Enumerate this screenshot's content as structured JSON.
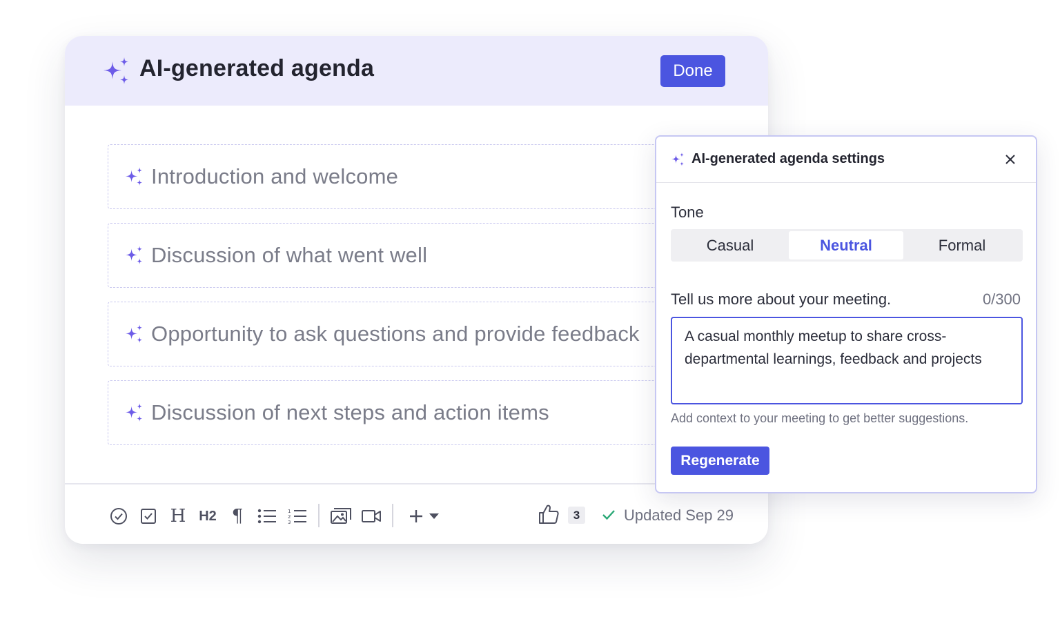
{
  "colors": {
    "accent": "#4b55e0",
    "sparkle": "#6d5ce8",
    "header_bg": "#ecebfc",
    "check_green": "#2aa876"
  },
  "card": {
    "title": "AI-generated agenda",
    "done_label": "Done",
    "agenda_items": [
      {
        "text": "Introduction and welcome",
        "icon": "sparkle-icon"
      },
      {
        "text": "Discussion of what went well",
        "icon": "sparkle-icon"
      },
      {
        "text": "Opportunity to ask questions and provide feedback",
        "icon": "sparkle-icon"
      },
      {
        "text": "Discussion of next steps and action items",
        "icon": "sparkle-icon"
      }
    ],
    "toolbar": {
      "heading_label": "H",
      "h2_label": "H2",
      "paragraph_label": "¶",
      "like_count": "3",
      "updated_text": "Updated Sep 29"
    }
  },
  "settings": {
    "title": "AI-generated agenda settings",
    "close_symbol": "×",
    "tone_label": "Tone",
    "tone_options": [
      "Casual",
      "Neutral",
      "Formal"
    ],
    "tone_selected": "Neutral",
    "meeting_label": "Tell us more about your meeting.",
    "char_count": "0/300",
    "meeting_text": "A casual monthly meetup to share cross-departmental learnings, feedback and projects",
    "helper_text": "Add context to your meeting to get better suggestions.",
    "regenerate_label": "Regenerate"
  }
}
